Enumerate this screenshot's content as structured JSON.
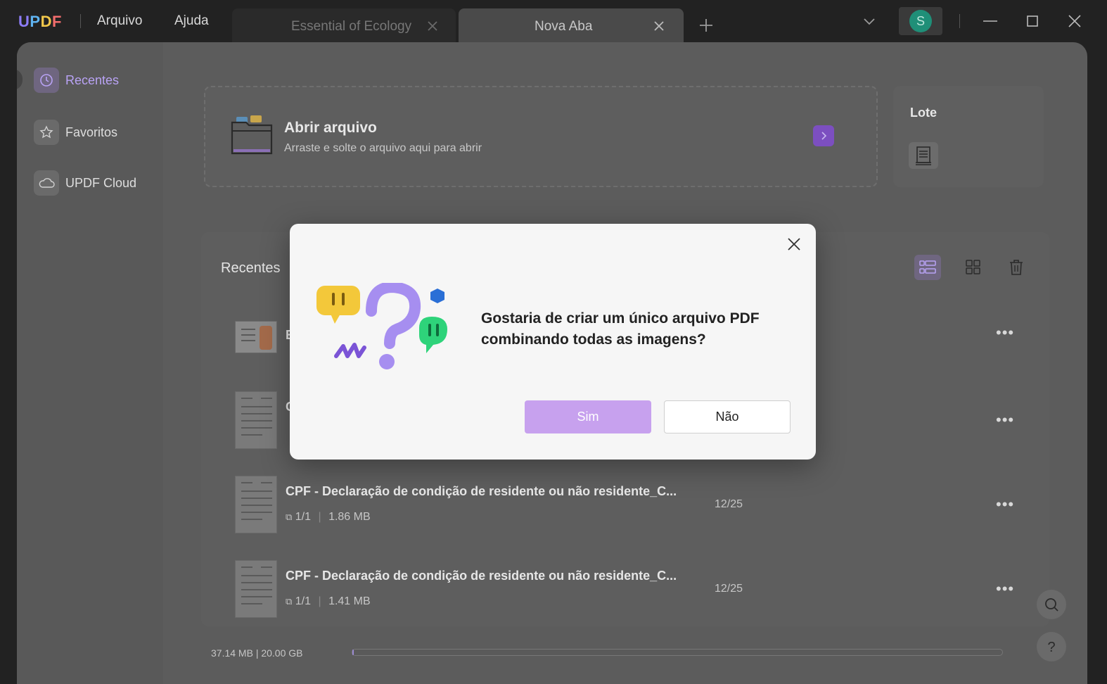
{
  "app": {
    "logo": "UPDF",
    "menu": [
      "Arquivo",
      "Ajuda"
    ],
    "tabs": [
      {
        "label": "Essential of Ecology",
        "active": false
      },
      {
        "label": "Nova Aba",
        "active": true
      }
    ],
    "user_initial": "S"
  },
  "sidebar": {
    "items": [
      {
        "label": "Recentes",
        "icon": "clock-icon",
        "active": true
      },
      {
        "label": "Favoritos",
        "icon": "star-icon",
        "active": false
      },
      {
        "label": "UPDF Cloud",
        "icon": "cloud-icon",
        "active": false
      }
    ]
  },
  "open_file": {
    "title": "Abrir arquivo",
    "subtitle": "Arraste e solte o arquivo aqui para abrir"
  },
  "batch": {
    "title": "Lote"
  },
  "recents": {
    "heading": "Recentes",
    "files": [
      {
        "name": "E",
        "pages": "",
        "size": "",
        "date": ""
      },
      {
        "name": "C",
        "pages": "",
        "size": "",
        "date": ""
      },
      {
        "name": "CPF - Declaração de condição de residente ou não residente_C...",
        "pages": "1/1",
        "size": "1.86 MB",
        "date": "12/25"
      },
      {
        "name": "CPF - Declaração de condição de residente ou não residente_C...",
        "pages": "1/1",
        "size": "1.41 MB",
        "date": "12/25"
      }
    ]
  },
  "storage": {
    "text": "37.14 MB | 20.00 GB",
    "used_fraction": 0.0018
  },
  "dialog": {
    "message": "Gostaria de criar um único arquivo PDF combinando todas as imagens?",
    "yes_label": "Sim",
    "no_label": "Não"
  },
  "colors": {
    "accent": "#b9a3f5",
    "primary_button": "#c7a1ee",
    "arrow_button": "#7c4fc0",
    "avatar": "#1f8f78"
  }
}
